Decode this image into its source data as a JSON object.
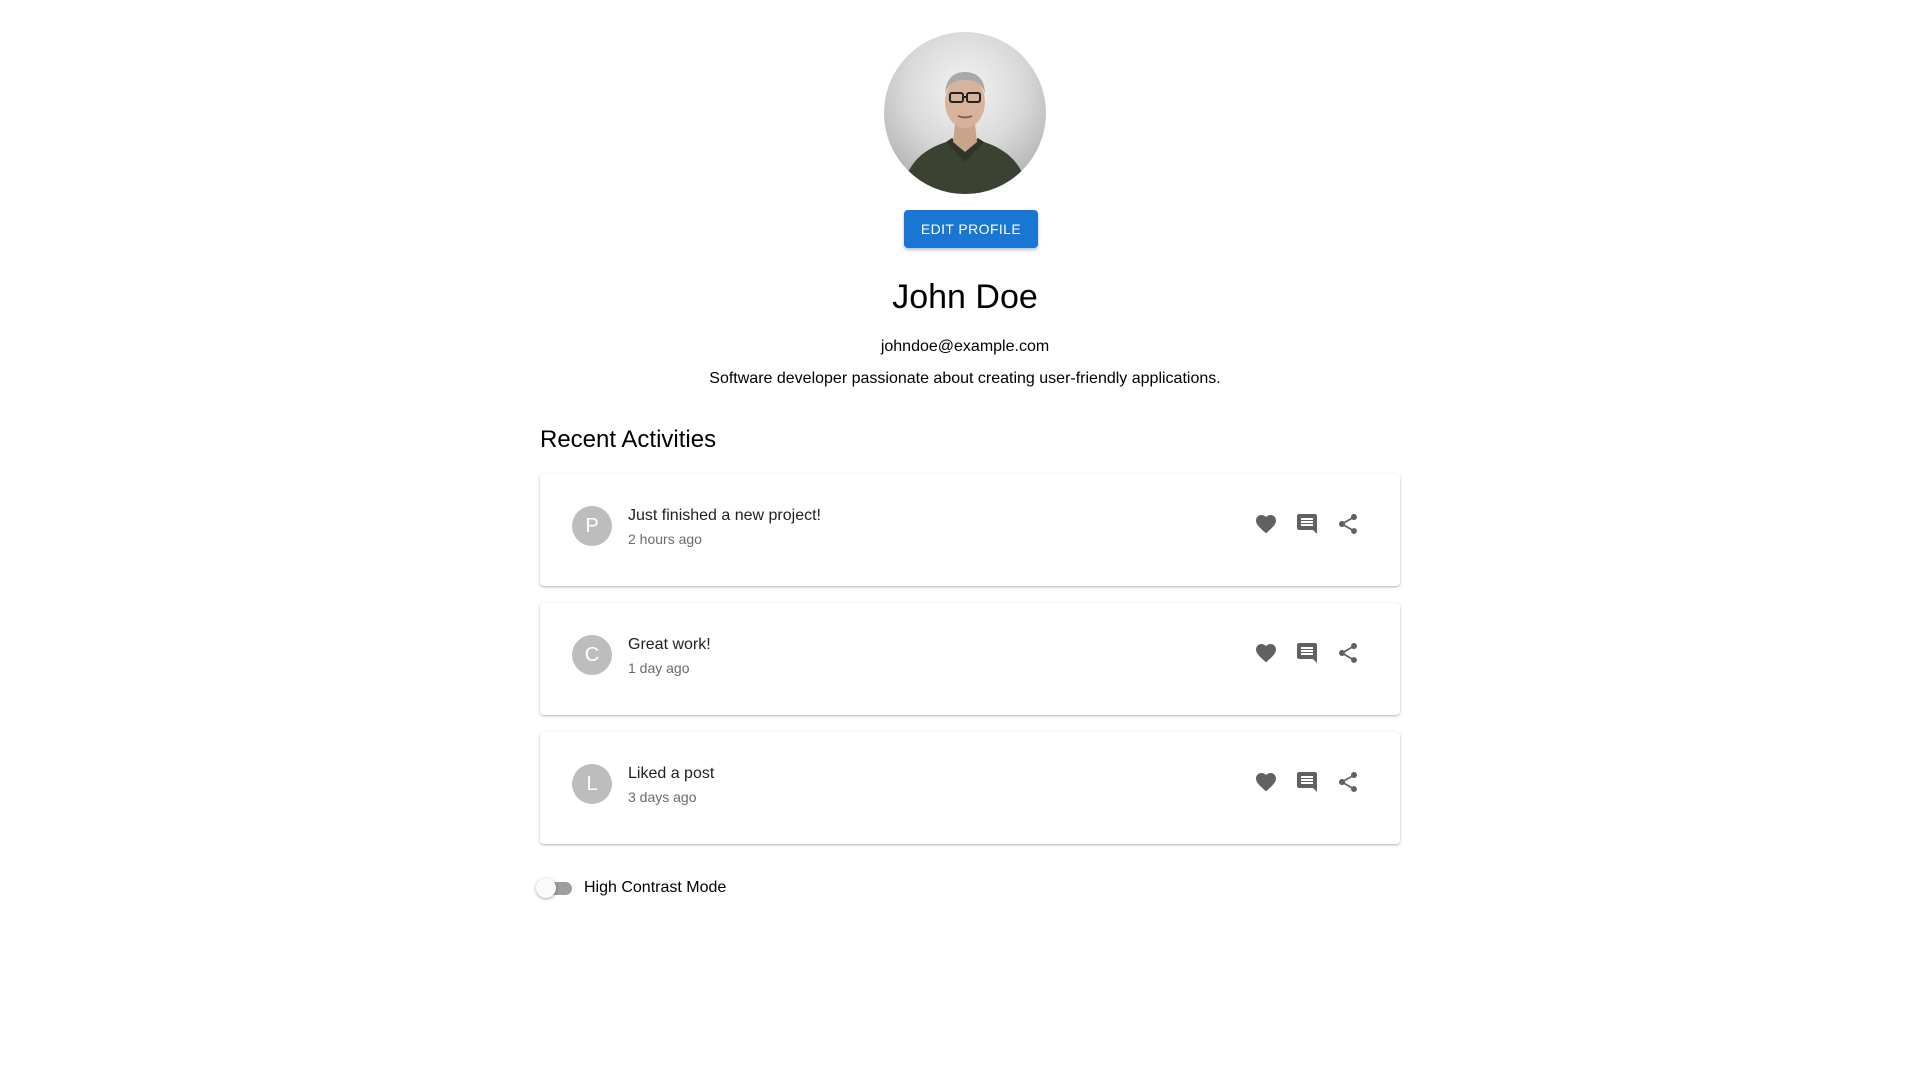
{
  "profile": {
    "avatar_icon": "profile-photo",
    "edit_button_label": "EDIT PROFILE",
    "name": "John Doe",
    "email": "johndoe@example.com",
    "bio": "Software developer passionate about creating user-friendly applications."
  },
  "activities": {
    "title": "Recent Activities",
    "items": [
      {
        "avatar_letter": "P",
        "text": "Just finished a new project!",
        "time": "2 hours ago"
      },
      {
        "avatar_letter": "C",
        "text": "Great work!",
        "time": "1 day ago"
      },
      {
        "avatar_letter": "L",
        "text": "Liked a post",
        "time": "3 days ago"
      }
    ],
    "action_icons": [
      "heart-icon",
      "comment-icon",
      "share-icon"
    ]
  },
  "settings": {
    "high_contrast_label": "High Contrast Mode",
    "high_contrast_enabled": false
  },
  "colors": {
    "primary": "#1976d2",
    "avatar_bg": "#bdbdbd",
    "icon": "#616161",
    "secondary_text": "#6b6b6b"
  }
}
